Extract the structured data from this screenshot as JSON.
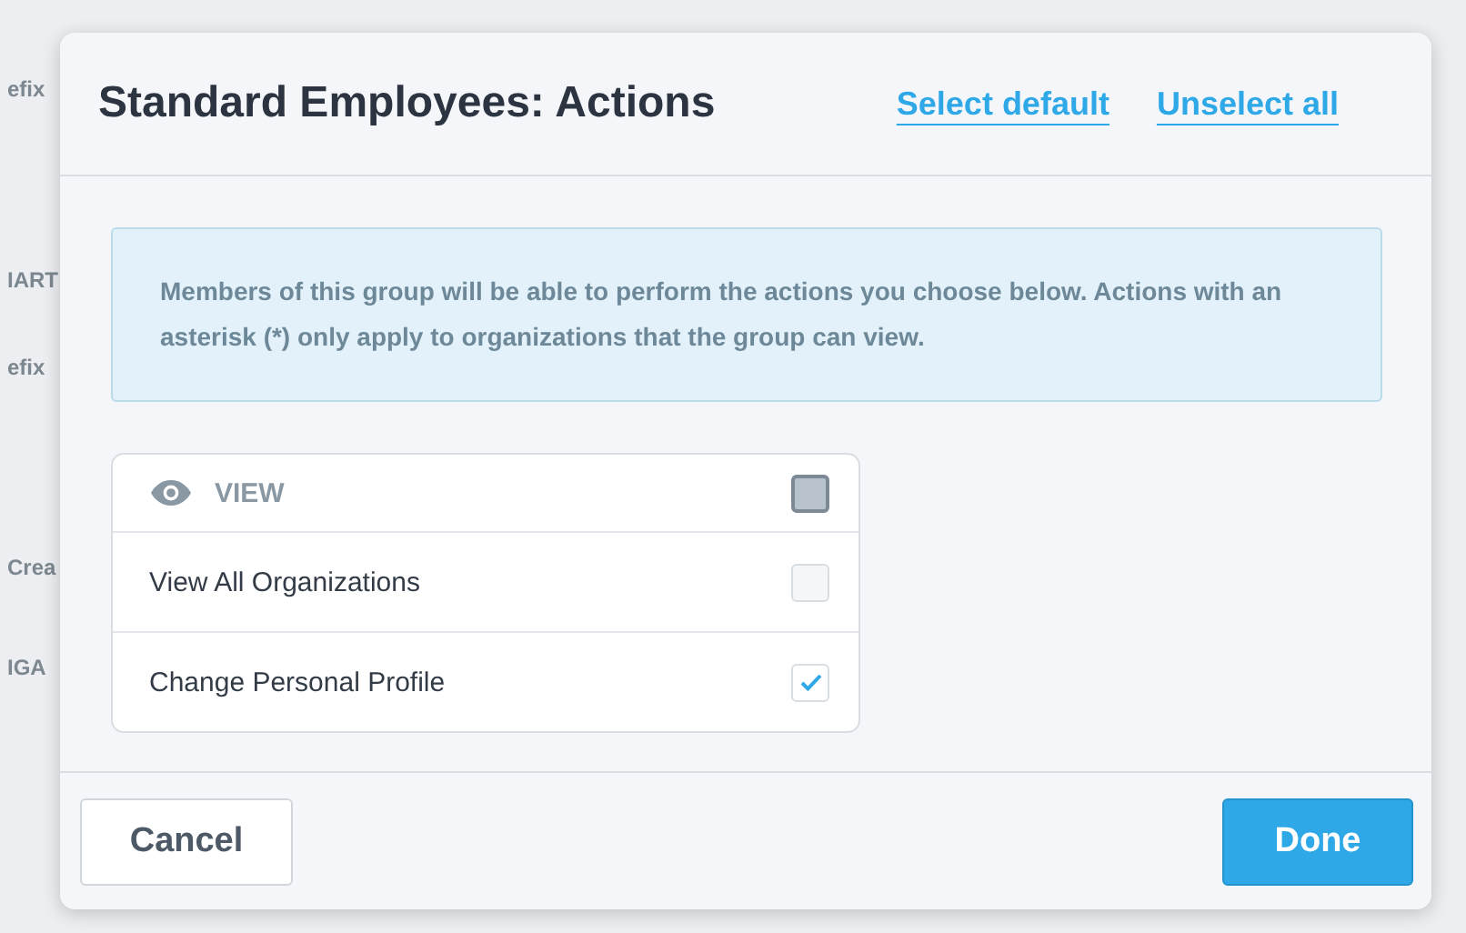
{
  "background": {
    "fragments": [
      "efix",
      "IART",
      "efix",
      "Crea",
      "IGA"
    ]
  },
  "dialog": {
    "title": "Standard Employees: Actions",
    "links": [
      "Select default",
      "Unselect all"
    ],
    "info": "Members of this group will be able to perform the actions you choose below. Actions with an asterisk (*) only apply to organizations that the group can view.",
    "group": {
      "label": "VIEW",
      "partial": true,
      "items": [
        {
          "label": "View All Organizations",
          "checked": false
        },
        {
          "label": "Change Personal Profile",
          "checked": true
        }
      ]
    },
    "buttons": [
      {
        "label": "Cancel",
        "kind": "secondary"
      },
      {
        "label": "Done",
        "kind": "primary"
      }
    ]
  }
}
